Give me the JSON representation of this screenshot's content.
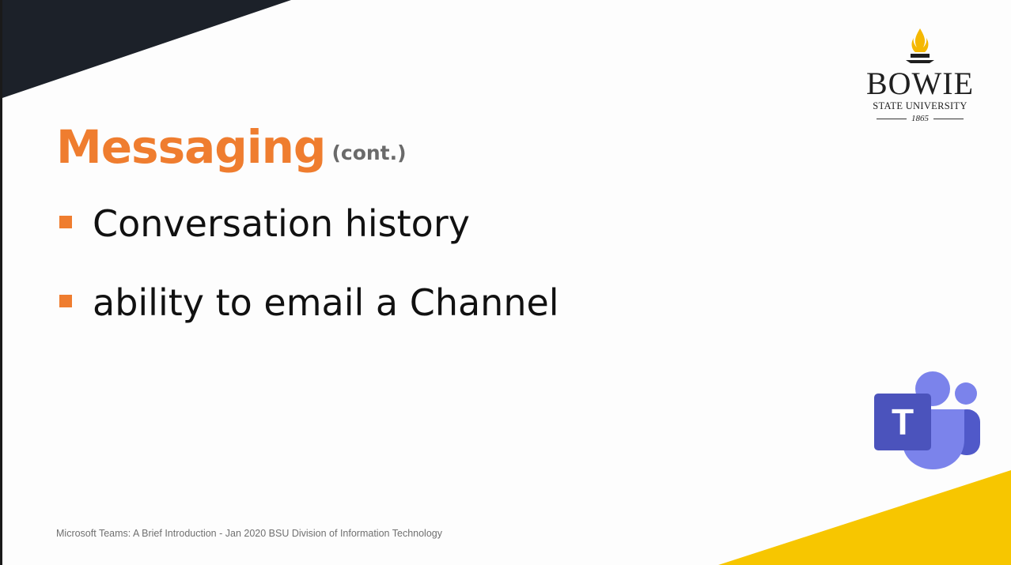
{
  "slide": {
    "title": "Messaging",
    "title_suffix": "(cont.)",
    "bullets": [
      {
        "text": "Conversation history"
      },
      {
        "text": "ability to email a Channel"
      }
    ],
    "footer": "Microsoft Teams: A Brief Introduction - Jan 2020 BSU Division of Information Technology"
  },
  "logo": {
    "name": "BOWIE",
    "subtitle": "STATE UNIVERSITY",
    "year": "1865",
    "icon": "torch-icon"
  },
  "teams_logo": {
    "letter": "T",
    "icon": "microsoft-teams-icon"
  },
  "colors": {
    "accent_orange": "#ef7d2f",
    "corner_dark": "#1c2129",
    "corner_yellow": "#f7c600",
    "teams_purple": "#5059c9"
  }
}
